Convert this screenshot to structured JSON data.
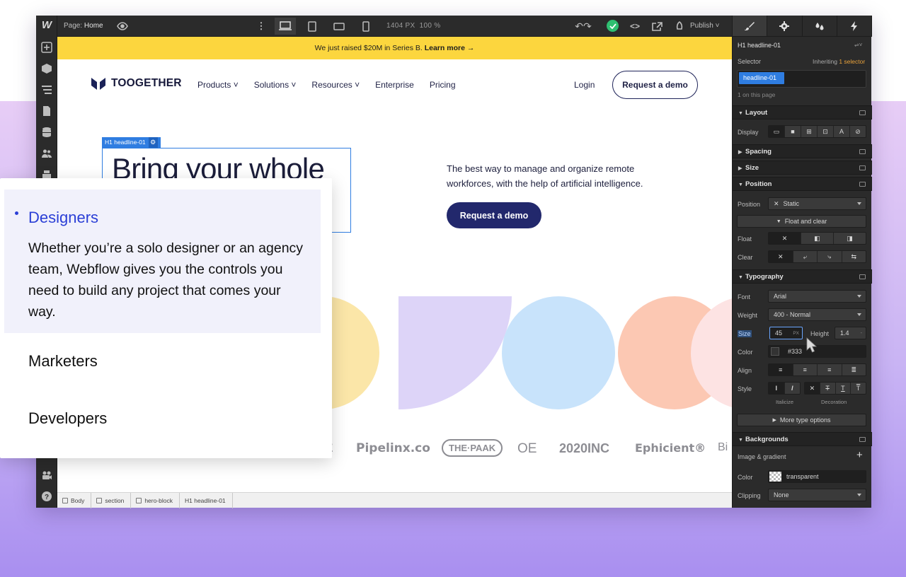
{
  "topbar": {
    "page_label": "Page:",
    "page_name": "Home",
    "px_readout": "1404 PX",
    "zoom": "100 %",
    "publish_label": "Publish"
  },
  "banner": {
    "text": "We just raised $20M in Series B.",
    "link": "Learn more",
    "arrow": "→"
  },
  "site": {
    "brand": "TOOGETHER",
    "nav": [
      "Products ˅",
      "Solutions ˅",
      "Resources ˅",
      "Enterprise",
      "Pricing"
    ],
    "login": "Login",
    "request_demo_outline": "Request a demo",
    "headline_tag": "H1 headline-01",
    "headline_gear": "⚙",
    "headline": "Bring your whole",
    "subtext": "The best way to manage and organize remote workforces, with the help of artificial intelligence.",
    "request_demo_filled": "Request a demo",
    "logos": [
      "Pipelinx.co",
      "THE·PAAK",
      "OE",
      "2020INC",
      "Ephicient®",
      "Bi"
    ],
    "logo_partial_left": "E"
  },
  "breadcrumbs": [
    "Body",
    "section",
    "hero-block",
    "H1 headline-01"
  ],
  "panel": {
    "element_name": "H1 headline-01",
    "selector_label": "Selector",
    "inheriting": "Inheriting",
    "inheriting_count": "1 selector",
    "selector_chip": "headline-01",
    "on_page": "1 on this page",
    "sections": {
      "layout": "Layout",
      "spacing": "Spacing",
      "size": "Size",
      "position": "Position",
      "typography": "Typography",
      "backgrounds": "Backgrounds"
    },
    "display_label": "Display",
    "position_label": "Position",
    "position_value": "Static",
    "float_clear": "Float and clear",
    "float_label": "Float",
    "clear_label": "Clear",
    "font_label": "Font",
    "font_value": "Arial",
    "weight_label": "Weight",
    "weight_value": "400 - Normal",
    "size_label": "Size",
    "size_value": "45",
    "size_unit": "PX",
    "height_label": "Height",
    "height_value": "1.4",
    "height_unit": "-",
    "color_label": "Color",
    "color_value": "#333",
    "align_label": "Align",
    "style_label": "Style",
    "italicize": "Italicize",
    "decoration": "Decoration",
    "more_type": "More type options",
    "image_gradient": "Image & gradient",
    "bg_color_label": "Color",
    "bg_color_value": "transparent",
    "clipping_label": "Clipping",
    "clipping_value": "None"
  },
  "card": {
    "item1_title": "Designers",
    "item1_body": "Whether you’re a solo designer or an agency team, Webflow gives you the controls you need to build any project that comes your way.",
    "item2_title": "Marketers",
    "item3_title": "Developers"
  },
  "colors": {
    "accent_blue": "#2f7de1",
    "banner_yellow": "#fcd63e",
    "brand_navy": "#22286c",
    "card_blue": "#2b3fd6",
    "success_green": "#2fbf71"
  }
}
